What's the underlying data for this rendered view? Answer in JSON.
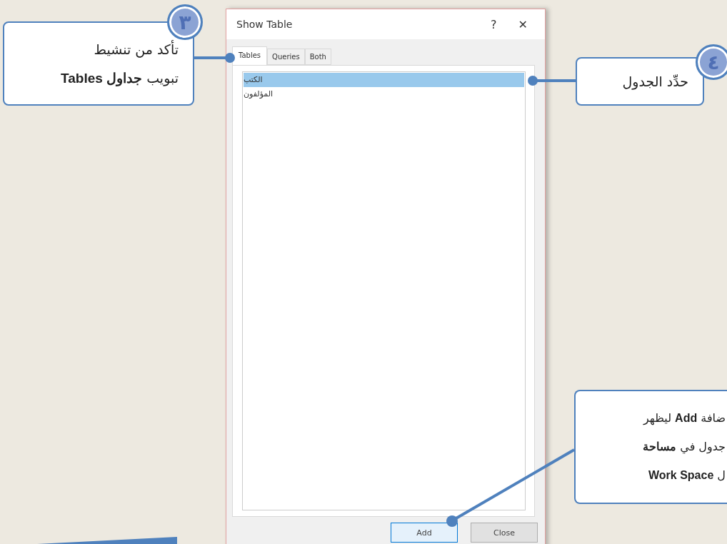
{
  "dialog": {
    "title": "Show Table",
    "help": "?",
    "close": "✕",
    "tabs": [
      {
        "label": "Both",
        "selected": false
      },
      {
        "label": "Queries",
        "selected": false
      },
      {
        "label": "Tables",
        "selected": true
      }
    ],
    "items": [
      {
        "label": "الكتب",
        "selected": true
      },
      {
        "label": "المؤلفون",
        "selected": false
      }
    ],
    "buttons": [
      {
        "label": "Close",
        "kind": "normal"
      },
      {
        "label": "Add",
        "kind": "default"
      }
    ]
  },
  "callouts": [
    {
      "number": "٤",
      "lines": [
        "حدِّد الجدول"
      ]
    },
    {
      "number": "٣",
      "lines": [
        "تأكد من تنشيط",
        "تبويب **جداول Tables**"
      ]
    },
    {
      "lines": [
        "ضافة **Add** ليظهر",
        "جدول في **مساحة**",
        "ل **Work Space**"
      ]
    }
  ]
}
